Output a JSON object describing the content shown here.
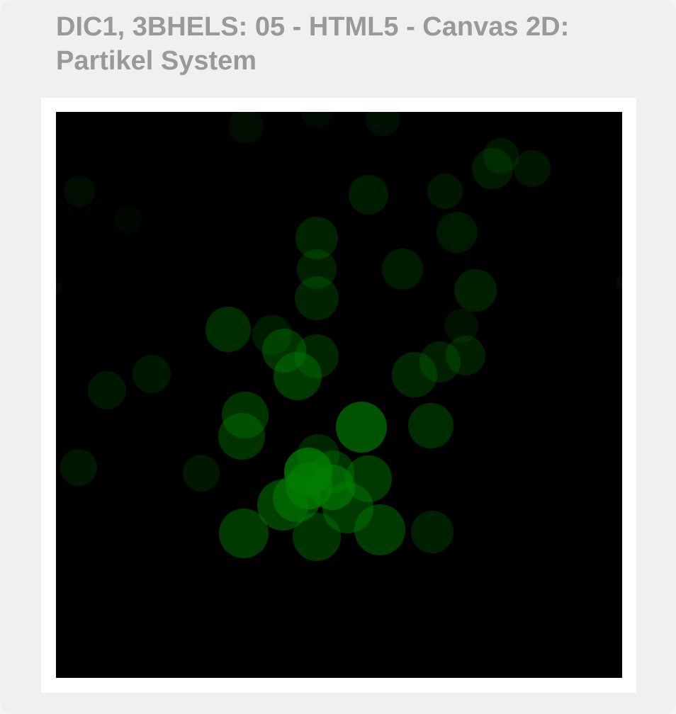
{
  "page": {
    "title": "DIC1, 3BHELS: 05 - HTML5 - Canvas 2D: Partikel System"
  },
  "colors": {
    "panel_background": "#f0f0f0",
    "title_text": "#999999",
    "canvas_frame": "#ffffff",
    "canvas_background": "#000000",
    "particle": "#008000"
  }
}
